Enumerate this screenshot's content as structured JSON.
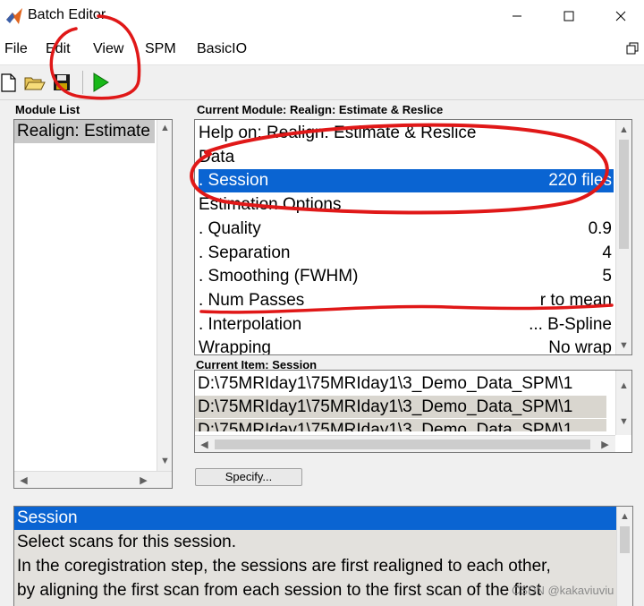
{
  "window": {
    "title": "Batch Editor",
    "minimize_glyph": "—",
    "maximize_glyph": "☐",
    "close_glyph": "✕"
  },
  "menu": {
    "items": [
      "File",
      "Edit",
      "View",
      "SPM",
      "BasicIO"
    ]
  },
  "toolbar": {
    "icons": [
      "new-file-icon",
      "open-folder-icon",
      "save-icon",
      "run-icon"
    ],
    "run_color": "#18b818"
  },
  "module_list": {
    "label": "Module List",
    "items": [
      "Realign: Estimate & Reslice"
    ]
  },
  "current_module": {
    "label": "Current Module: Realign: Estimate & Reslice",
    "rows": [
      {
        "text": "Help on: Realign: Estimate & Reslice",
        "value": ""
      },
      {
        "text": "Data",
        "value": ""
      },
      {
        "text": ". Session",
        "value": "220 files",
        "selected": true
      },
      {
        "text": "Estimation Options",
        "value": ""
      },
      {
        "text": ". Quality",
        "value": "0.9"
      },
      {
        "text": ". Separation",
        "value": "4"
      },
      {
        "text": ". Smoothing (FWHM)",
        "value": "5"
      },
      {
        "text": ". Num Passes",
        "value": "r to mean"
      },
      {
        "text": ". Interpolation",
        "value": "... B-Spline"
      },
      {
        "text": "Wrapping",
        "value": "No wrap"
      }
    ]
  },
  "current_item": {
    "label": "Current Item: Session",
    "rows": [
      "D:\\75MRIday1\\75MRIday1\\3_Demo_Data_SPM\\1",
      "D:\\75MRIday1\\75MRIday1\\3_Demo_Data_SPM\\1",
      "D:\\75MRIday1\\75MRIday1\\3_Demo_Data_SPM\\1"
    ]
  },
  "specify_button": {
    "label": "Specify..."
  },
  "help": {
    "title": "Session",
    "lines": [
      "Select scans for this session.",
      "In the coregistration step, the sessions are first realigned to each other,",
      "by  aligning  the  first scan from each session to the first scan of the first"
    ]
  },
  "watermark": "CSDN @kakaviuviu",
  "colors": {
    "selection": "#0a64d2",
    "annotation": "#e01818"
  }
}
